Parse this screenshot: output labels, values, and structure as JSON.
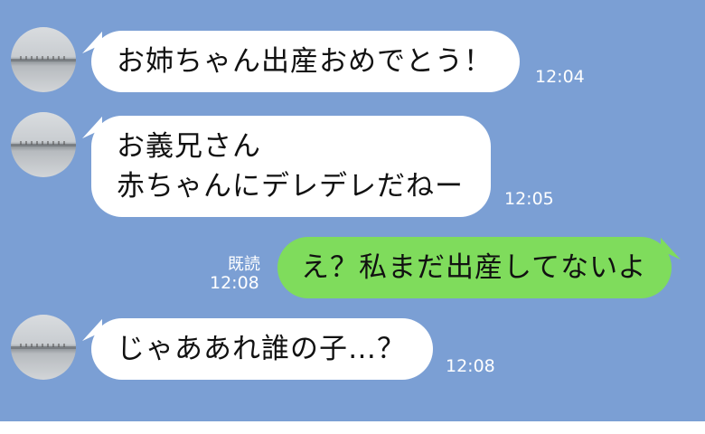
{
  "messages": [
    {
      "sender": "other",
      "text_lines": [
        "お姉ちゃん出産おめでとう！"
      ],
      "time": "12:04"
    },
    {
      "sender": "other",
      "text_lines": [
        "お義兄さん",
        "赤ちゃんにデレデレだねー"
      ],
      "time": "12:05"
    },
    {
      "sender": "me",
      "text_lines": [
        "え？私まだ出産してないよ"
      ],
      "time": "12:08",
      "read_label": "既読"
    },
    {
      "sender": "other",
      "text_lines": [
        "じゃああれ誰の子…？"
      ],
      "time": "12:08"
    }
  ],
  "colors": {
    "chat_background": "#7b9fd4",
    "incoming_bubble": "#ffffff",
    "outgoing_bubble": "#7fdc5c"
  }
}
